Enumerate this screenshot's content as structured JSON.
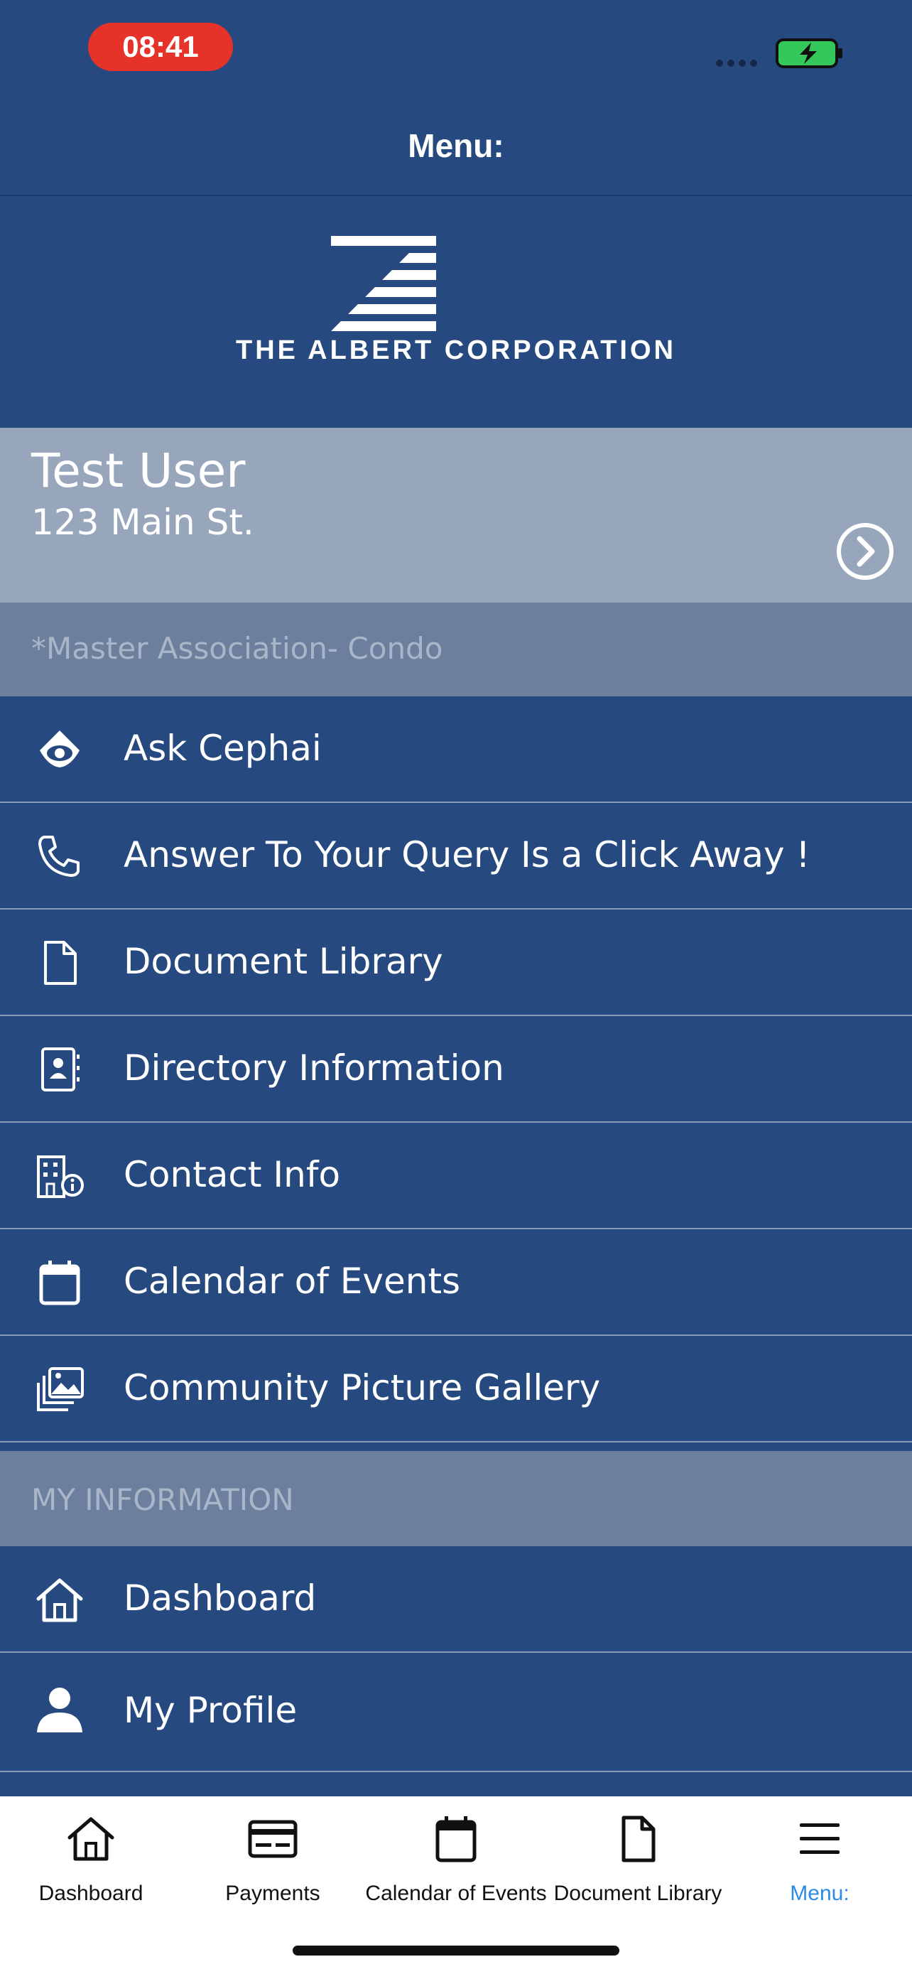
{
  "status_bar": {
    "time": "08:41"
  },
  "header": {
    "title": "Menu:"
  },
  "logo": {
    "text": "THE ALBERT CORPORATION"
  },
  "user": {
    "name": "Test User",
    "address": "123 Main St."
  },
  "association": "*Master Association- Condo",
  "menu_items": [
    {
      "label": "Ask Cephai",
      "icon": "eye-shield-icon"
    },
    {
      "label": "Answer To Your Query Is a Click Away !",
      "icon": "phone-icon"
    },
    {
      "label": "Document Library",
      "icon": "document-icon"
    },
    {
      "label": "Directory Information",
      "icon": "contact-card-icon"
    },
    {
      "label": "Contact Info",
      "icon": "building-info-icon"
    },
    {
      "label": "Calendar of Events",
      "icon": "calendar-icon"
    },
    {
      "label": "Community Picture Gallery",
      "icon": "gallery-icon"
    }
  ],
  "my_information": {
    "heading": "MY INFORMATION",
    "items": [
      {
        "label": "Dashboard",
        "icon": "home-icon"
      },
      {
        "label": "My Profile",
        "icon": "person-icon"
      }
    ]
  },
  "tab_bar": {
    "active_color": "#2b8be6",
    "tabs": [
      {
        "label": "Dashboard",
        "icon": "home-icon"
      },
      {
        "label": "Payments",
        "icon": "payments-icon"
      },
      {
        "label": "Calendar of Events",
        "icon": "calendar-icon"
      },
      {
        "label": "Document Library",
        "icon": "document-icon"
      },
      {
        "label": "Menu:",
        "icon": "hamburger-icon",
        "active": true
      }
    ]
  }
}
